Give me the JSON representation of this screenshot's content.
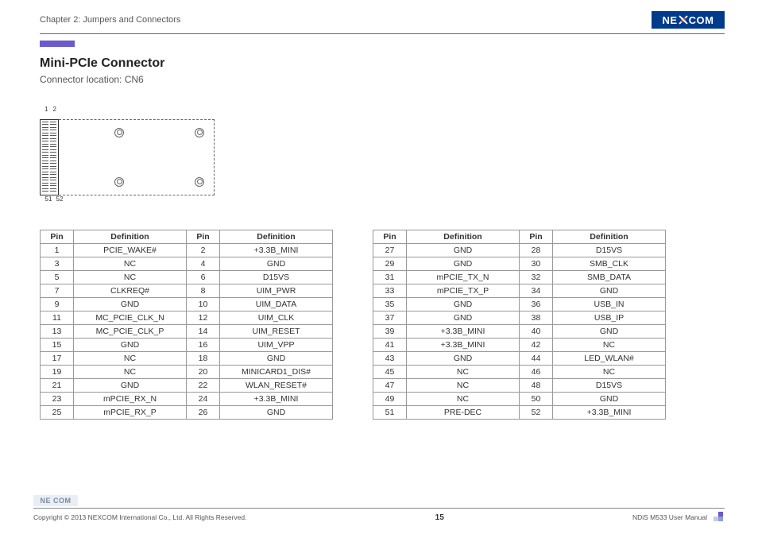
{
  "header": {
    "chapter": "Chapter 2: Jumpers and Connectors",
    "logo_text_left": "NE",
    "logo_text_right": "COM"
  },
  "section": {
    "title": "Mini-PCIe Connector",
    "subtitle": "Connector location: CN6"
  },
  "diagram": {
    "top_left_pin": "1",
    "top_right_pin": "2",
    "bottom_left_pin": "51",
    "bottom_right_pin": "52"
  },
  "table_headers": {
    "pin": "Pin",
    "definition": "Definition"
  },
  "table_left": [
    {
      "p1": "1",
      "d1": "PCIE_WAKE#",
      "p2": "2",
      "d2": "+3.3B_MINI"
    },
    {
      "p1": "3",
      "d1": "NC",
      "p2": "4",
      "d2": "GND"
    },
    {
      "p1": "5",
      "d1": "NC",
      "p2": "6",
      "d2": "D15VS"
    },
    {
      "p1": "7",
      "d1": "CLKREQ#",
      "p2": "8",
      "d2": "UIM_PWR"
    },
    {
      "p1": "9",
      "d1": "GND",
      "p2": "10",
      "d2": "UIM_DATA"
    },
    {
      "p1": "11",
      "d1": "MC_PCIE_CLK_N",
      "p2": "12",
      "d2": "UIM_CLK"
    },
    {
      "p1": "13",
      "d1": "MC_PCIE_CLK_P",
      "p2": "14",
      "d2": "UIM_RESET"
    },
    {
      "p1": "15",
      "d1": "GND",
      "p2": "16",
      "d2": "UIM_VPP"
    },
    {
      "p1": "17",
      "d1": "NC",
      "p2": "18",
      "d2": "GND"
    },
    {
      "p1": "19",
      "d1": "NC",
      "p2": "20",
      "d2": "MINICARD1_DIS#"
    },
    {
      "p1": "21",
      "d1": "GND",
      "p2": "22",
      "d2": "WLAN_RESET#"
    },
    {
      "p1": "23",
      "d1": "mPCIE_RX_N",
      "p2": "24",
      "d2": "+3.3B_MINI"
    },
    {
      "p1": "25",
      "d1": "mPCIE_RX_P",
      "p2": "26",
      "d2": "GND"
    }
  ],
  "table_right": [
    {
      "p1": "27",
      "d1": "GND",
      "p2": "28",
      "d2": "D15VS"
    },
    {
      "p1": "29",
      "d1": "GND",
      "p2": "30",
      "d2": "SMB_CLK"
    },
    {
      "p1": "31",
      "d1": "mPCIE_TX_N",
      "p2": "32",
      "d2": "SMB_DATA"
    },
    {
      "p1": "33",
      "d1": "mPCIE_TX_P",
      "p2": "34",
      "d2": "GND"
    },
    {
      "p1": "35",
      "d1": "GND",
      "p2": "36",
      "d2": "USB_IN"
    },
    {
      "p1": "37",
      "d1": "GND",
      "p2": "38",
      "d2": "USB_IP"
    },
    {
      "p1": "39",
      "d1": "+3.3B_MINI",
      "p2": "40",
      "d2": "GND"
    },
    {
      "p1": "41",
      "d1": "+3.3B_MINI",
      "p2": "42",
      "d2": "NC"
    },
    {
      "p1": "43",
      "d1": "GND",
      "p2": "44",
      "d2": "LED_WLAN#"
    },
    {
      "p1": "45",
      "d1": "NC",
      "p2": "46",
      "d2": "NC"
    },
    {
      "p1": "47",
      "d1": "NC",
      "p2": "48",
      "d2": "D15VS"
    },
    {
      "p1": "49",
      "d1": "NC",
      "p2": "50",
      "d2": "GND"
    },
    {
      "p1": "51",
      "d1": "PRE-DEC",
      "p2": "52",
      "d2": "+3.3B_MINI"
    }
  ],
  "footer": {
    "copyright": "Copyright © 2013 NEXCOM International Co., Ltd. All Rights Reserved.",
    "page": "15",
    "manual": "NDiS M533 User Manual",
    "logo_text": "NE COM"
  }
}
